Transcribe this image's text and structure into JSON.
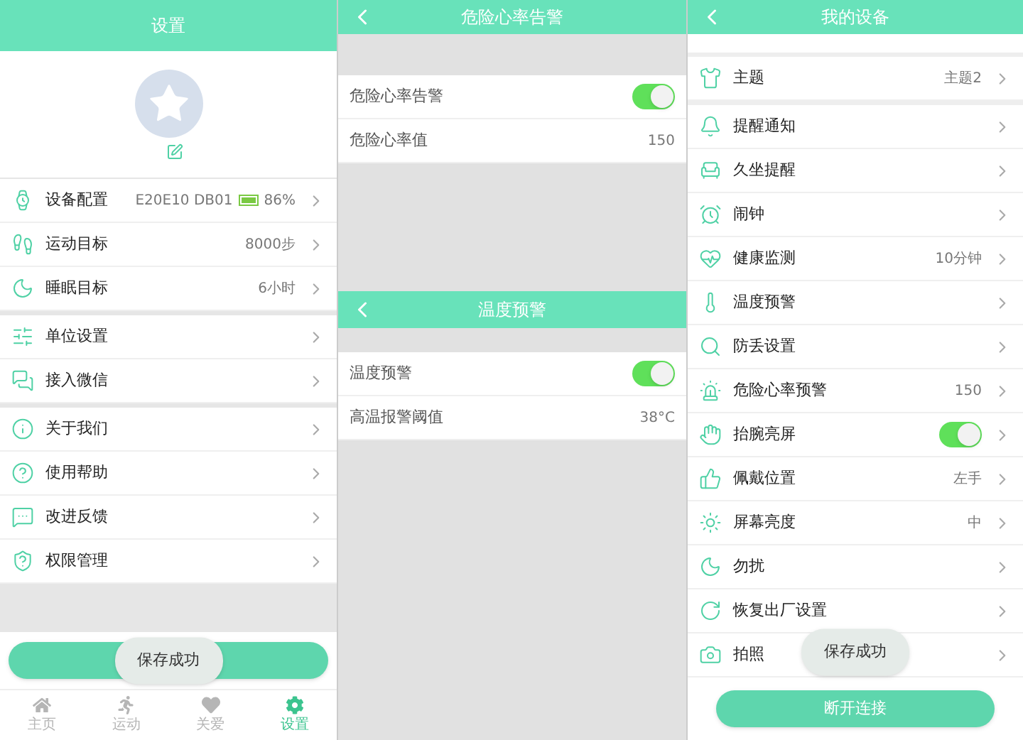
{
  "settings_screen": {
    "title": "设置",
    "groups": [
      [
        {
          "kind": "device",
          "label": "设备配置",
          "value": "E20E10 DB01",
          "battery": "86%"
        },
        {
          "kind": "link",
          "label": "运动目标",
          "value": "8000步"
        },
        {
          "kind": "link",
          "label": "睡眠目标",
          "value": "6小时"
        }
      ],
      [
        {
          "kind": "link",
          "label": "单位设置"
        },
        {
          "kind": "link",
          "label": "接入微信"
        }
      ],
      [
        {
          "kind": "link",
          "label": "关于我们"
        },
        {
          "kind": "link",
          "label": "使用帮助"
        },
        {
          "kind": "link",
          "label": "改进反馈"
        },
        {
          "kind": "link",
          "label": "权限管理"
        }
      ]
    ],
    "toast": "保存成功",
    "nav": [
      {
        "label": "主页",
        "selected": false
      },
      {
        "label": "运动",
        "selected": false
      },
      {
        "label": "关爱",
        "selected": false
      },
      {
        "label": "设置",
        "selected": true
      }
    ]
  },
  "heart_rate_screen": {
    "title": "危险心率告警",
    "rows": [
      {
        "kind": "toggle",
        "label": "危险心率告警",
        "on": true
      },
      {
        "kind": "link",
        "label": "危险心率值",
        "value": "150"
      }
    ]
  },
  "temperature_screen": {
    "title": "温度预警",
    "rows": [
      {
        "kind": "toggle",
        "label": "温度预警",
        "on": true
      },
      {
        "kind": "link",
        "label": "高温报警阈值",
        "value": "38°C"
      }
    ]
  },
  "device_screen": {
    "title": "我的设备",
    "groups": [
      [
        {
          "kind": "link",
          "label": "主题",
          "value": "主题2"
        }
      ],
      [
        {
          "kind": "link",
          "label": "提醒通知"
        },
        {
          "kind": "link",
          "label": "久坐提醒"
        },
        {
          "kind": "link",
          "label": "闹钟"
        },
        {
          "kind": "link",
          "label": "健康监测",
          "value": "10分钟"
        },
        {
          "kind": "link",
          "label": "温度预警"
        },
        {
          "kind": "link",
          "label": "防丢设置"
        },
        {
          "kind": "link",
          "label": "危险心率预警",
          "value": "150"
        },
        {
          "kind": "toggle",
          "label": "抬腕亮屏",
          "on": true
        },
        {
          "kind": "link",
          "label": "佩戴位置",
          "value": "左手"
        },
        {
          "kind": "link",
          "label": "屏幕亮度",
          "value": "中"
        },
        {
          "kind": "link",
          "label": "勿扰"
        },
        {
          "kind": "link",
          "label": "恢复出厂设置"
        },
        {
          "kind": "link",
          "label": "拍照"
        }
      ]
    ],
    "toast": "保存成功",
    "button": "断开连接"
  }
}
